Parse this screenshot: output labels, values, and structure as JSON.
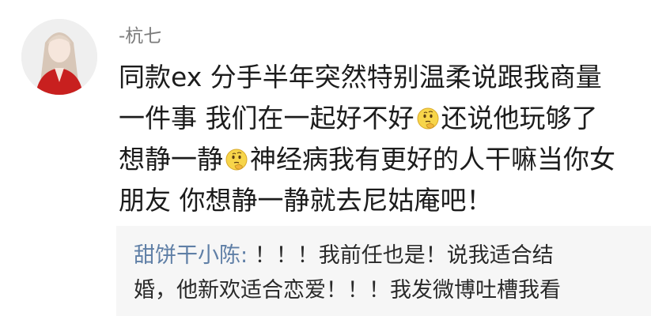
{
  "comment": {
    "username": "-杭七",
    "avatar_icon": "avatar-girl-red-coat-icon",
    "lines": [
      [
        "同款ex 分手半年突然特别温柔说跟我商量"
      ],
      [
        "一件事 我们在一起好不好",
        "还说他玩够了"
      ],
      [
        "想静一静",
        "神经病我有更好的人干嘛当你女"
      ],
      [
        "朋友 你想静一静就去尼姑庵吧！"
      ]
    ],
    "emoji_name": "thinking-face-icon"
  },
  "reply": {
    "author": "甜饼干小陈:",
    "line1_text": " ！！！我前任也是！说我适合结",
    "line2_text": "婚，他新欢适合恋爱！！！我发微博吐槽我看"
  },
  "colors": {
    "username": "#7c7c7c",
    "reply_author": "#5f7fa6",
    "reply_bg": "#f6f6f6",
    "text": "#1c1c1c"
  }
}
